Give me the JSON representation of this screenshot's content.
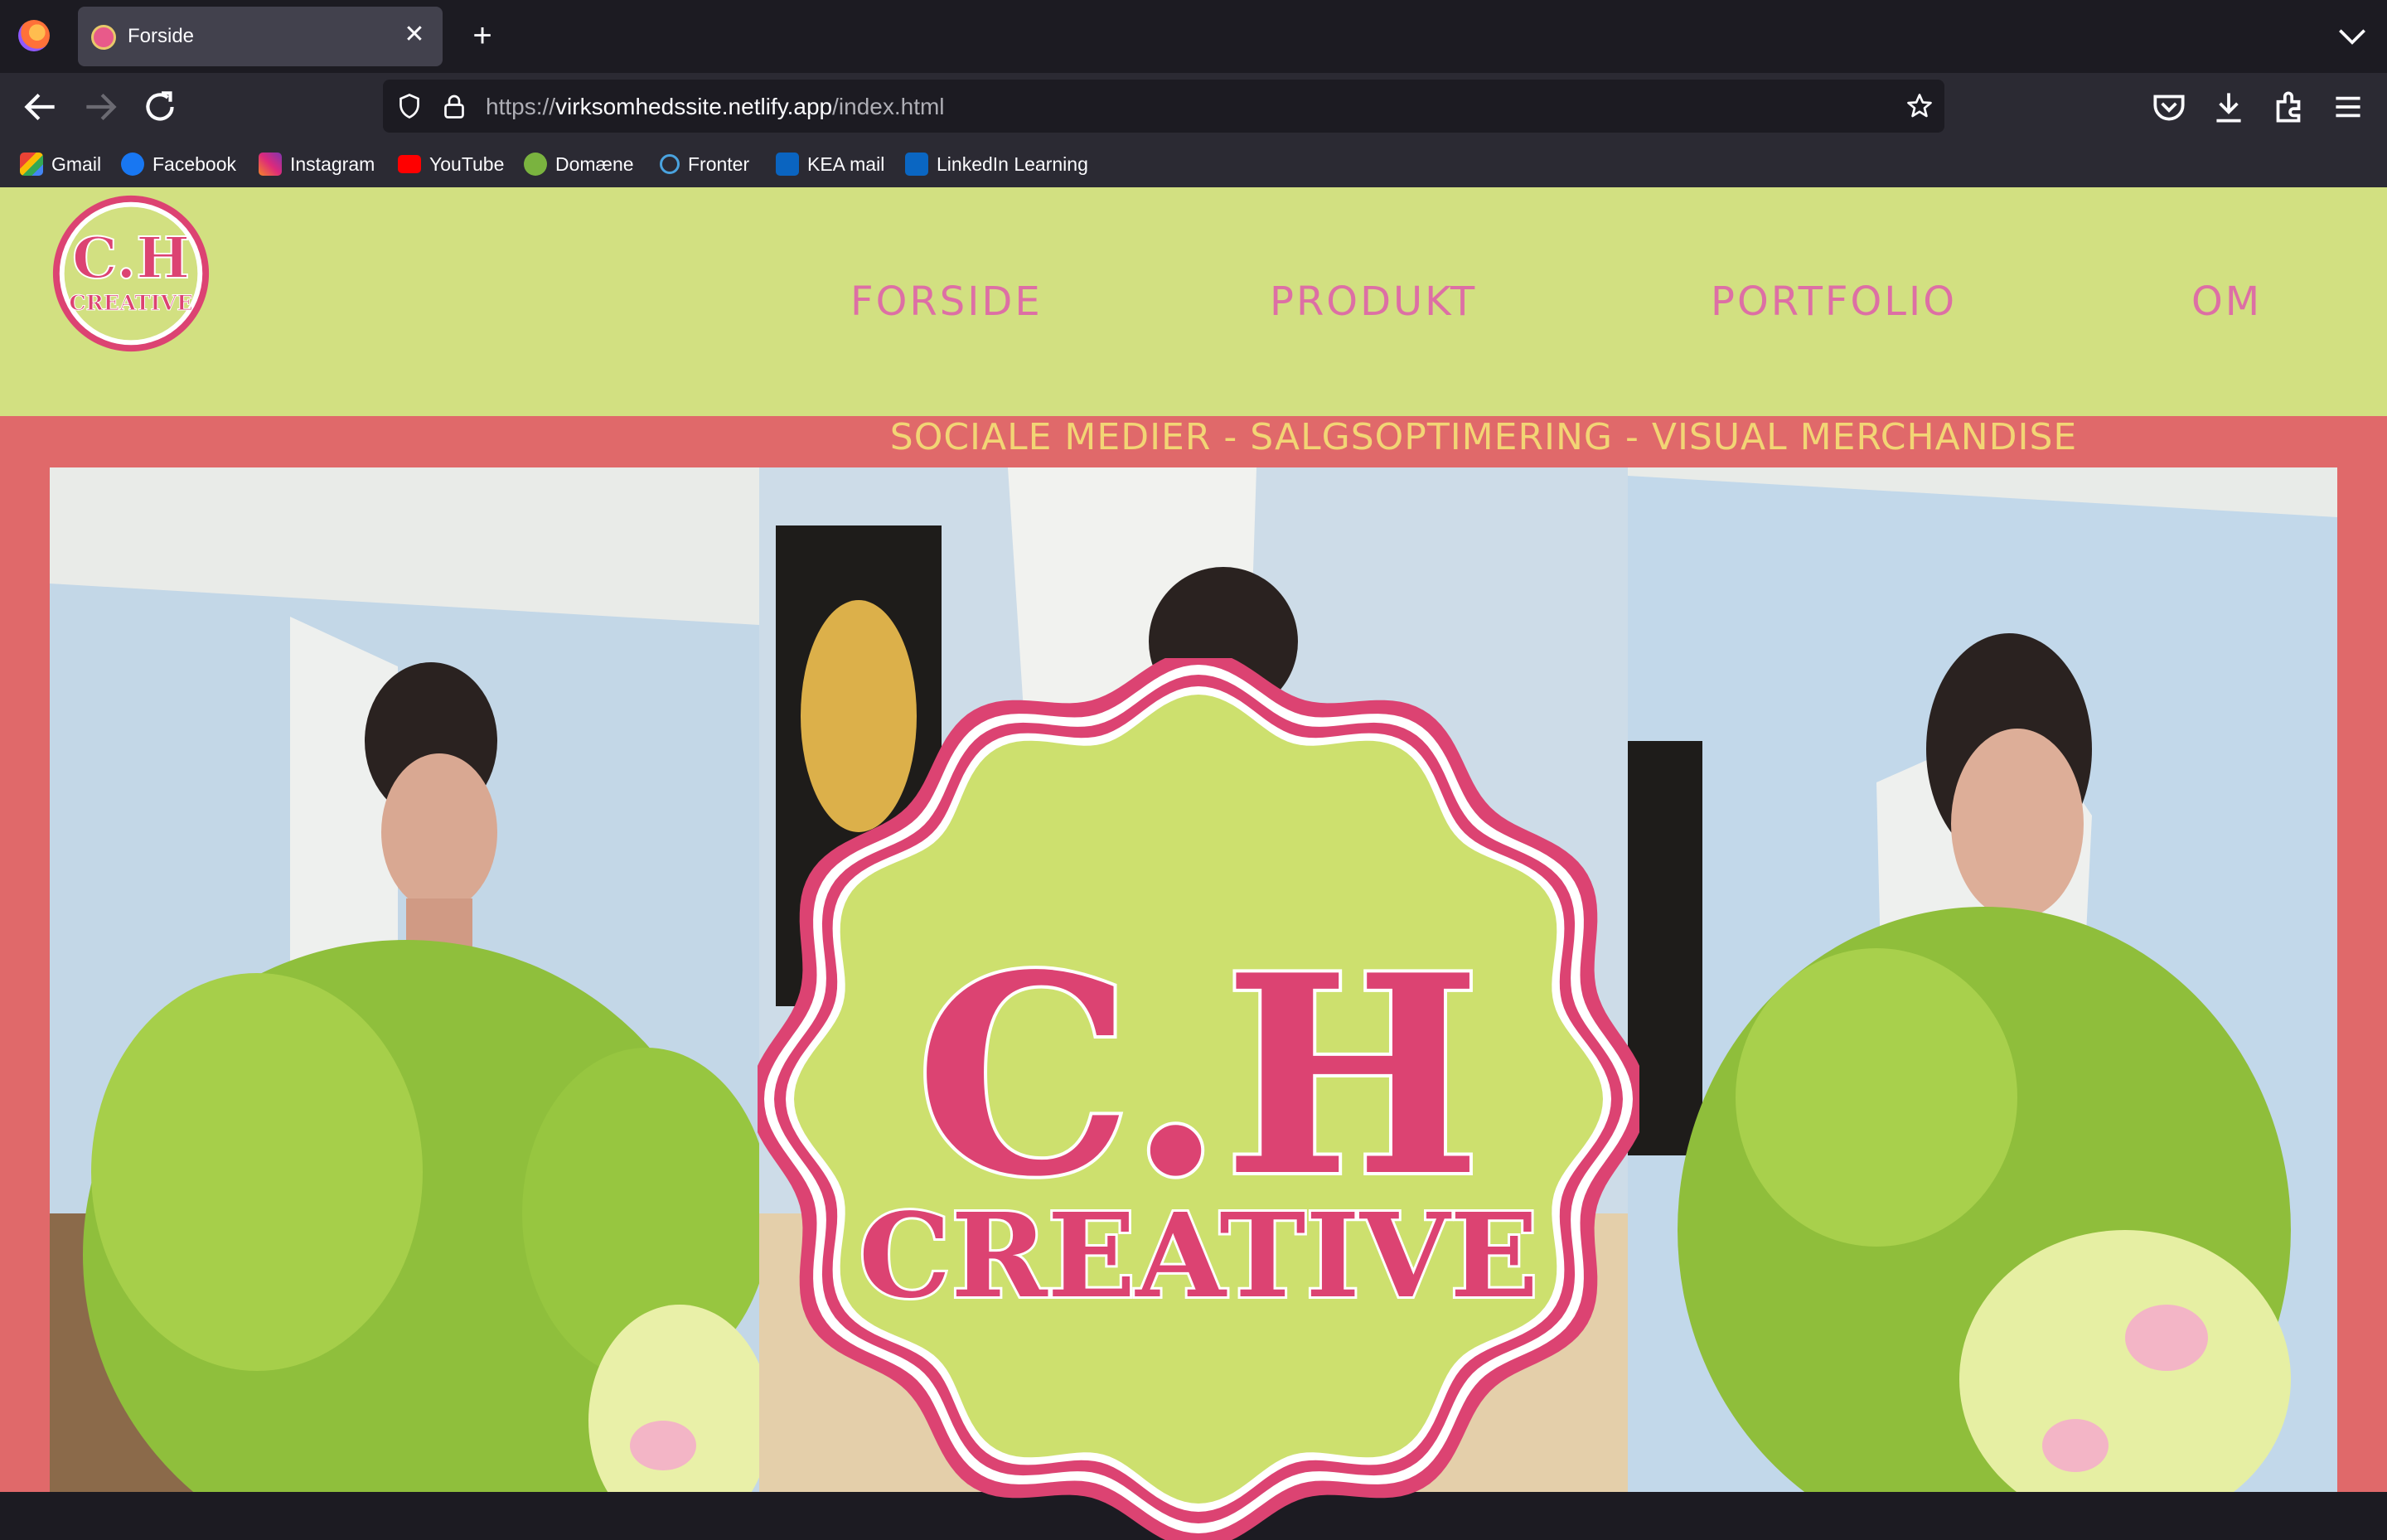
{
  "browser": {
    "tab_title": "Forside",
    "url_protocol": "https://",
    "url_domain": "virksomhedssite.netlify.app",
    "url_path": "/index.html",
    "bookmarks": [
      {
        "label": "Gmail",
        "icon": "gmail-icon"
      },
      {
        "label": "Facebook",
        "icon": "facebook-icon"
      },
      {
        "label": "Instagram",
        "icon": "instagram-icon"
      },
      {
        "label": "YouTube",
        "icon": "youtube-icon"
      },
      {
        "label": "Domæne",
        "icon": "domain-icon"
      },
      {
        "label": "Fronter",
        "icon": "fronter-icon"
      },
      {
        "label": "KEA mail",
        "icon": "outlook-icon"
      },
      {
        "label": "LinkedIn Learning",
        "icon": "linkedin-learning-icon"
      }
    ]
  },
  "site": {
    "logo_line1": "C.H",
    "logo_line2": "CREATIVE",
    "nav": [
      "FORSIDE",
      "PRODUKT",
      "PORTFOLIO",
      "OM"
    ],
    "tagline": "SOCIALE MEDIER - SALGSOPTIMERING - VISUAL MERCHANDISE"
  },
  "colors": {
    "header_bg": "#d2e081",
    "band_bg": "#e0696a",
    "nav_text": "#dd6fa5",
    "tagline_text": "#f2d575",
    "logo_pink": "#dc4372"
  }
}
